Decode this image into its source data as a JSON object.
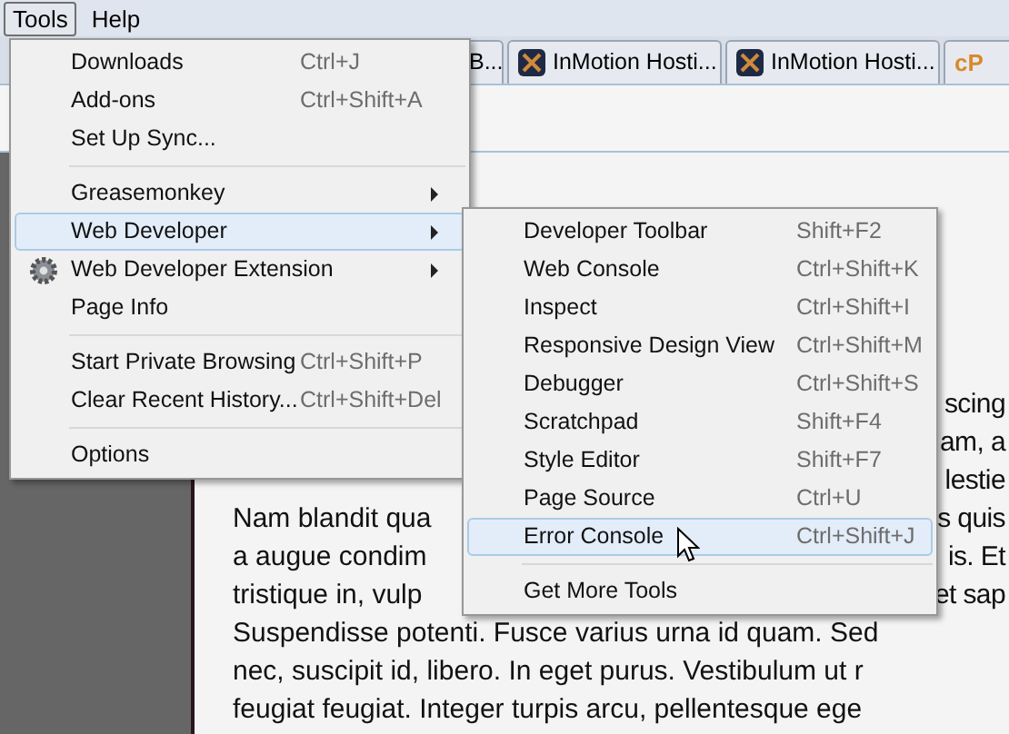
{
  "menu_bar": [
    {
      "label": "Tools",
      "selected": true
    },
    {
      "label": "Help",
      "selected": false
    }
  ],
  "tabs": [
    {
      "label": "B...",
      "kind": "plain"
    },
    {
      "label": "InMotion Hosti...",
      "kind": "site"
    },
    {
      "label": "InMotion Hosti...",
      "kind": "site"
    },
    {
      "kind": "cpanel",
      "logo_text": "cP"
    }
  ],
  "tools_menu": [
    {
      "kind": "item",
      "label": "Downloads",
      "shortcut": "Ctrl+J",
      "selected": false
    },
    {
      "kind": "item",
      "label": "Add-ons",
      "shortcut": "Ctrl+Shift+A",
      "selected": false
    },
    {
      "kind": "item",
      "label": "Set Up Sync...",
      "selected": false
    },
    {
      "kind": "separator"
    },
    {
      "kind": "submenu",
      "label": "Greasemonkey",
      "selected": false
    },
    {
      "kind": "submenu",
      "label": "Web Developer",
      "selected": true
    },
    {
      "kind": "submenu",
      "label": "Web Developer Extension",
      "selected": false,
      "icon": true
    },
    {
      "kind": "item",
      "label": "Page Info",
      "selected": false
    },
    {
      "kind": "separator"
    },
    {
      "kind": "item",
      "label": "Start Private Browsing",
      "shortcut": "Ctrl+Shift+P",
      "selected": false
    },
    {
      "kind": "item",
      "label": "Clear Recent History...",
      "shortcut": "Ctrl+Shift+Del",
      "selected": false
    },
    {
      "kind": "separator"
    },
    {
      "kind": "item",
      "label": "Options",
      "selected": false
    }
  ],
  "web_developer_menu": [
    {
      "kind": "item",
      "label": "Developer Toolbar",
      "shortcut": "Shift+F2",
      "selected": false
    },
    {
      "kind": "item",
      "label": "Web Console",
      "shortcut": "Ctrl+Shift+K",
      "selected": false
    },
    {
      "kind": "item",
      "label": "Inspect",
      "shortcut": "Ctrl+Shift+I",
      "selected": false
    },
    {
      "kind": "item",
      "label": "Responsive Design View",
      "shortcut": "Ctrl+Shift+M",
      "selected": false
    },
    {
      "kind": "item",
      "label": "Debugger",
      "shortcut": "Ctrl+Shift+S",
      "selected": false
    },
    {
      "kind": "item",
      "label": "Scratchpad",
      "shortcut": "Shift+F4",
      "selected": false
    },
    {
      "kind": "item",
      "label": "Style Editor",
      "shortcut": "Shift+F7",
      "selected": false
    },
    {
      "kind": "item",
      "label": "Page Source",
      "shortcut": "Ctrl+U",
      "selected": false
    },
    {
      "kind": "item",
      "label": "Error Console",
      "shortcut": "Ctrl+Shift+J",
      "selected": true
    },
    {
      "kind": "separator"
    },
    {
      "kind": "item",
      "label": "Get More Tools",
      "selected": false
    }
  ],
  "page_text": [
    {
      "right": "scing"
    },
    {
      "right": "am, a"
    },
    {
      "right": "lestie"
    },
    {
      "left": "Nam blandit qua",
      "right": "s quis"
    },
    {
      "left": "a augue condim",
      "right": "is. Et"
    },
    {
      "left": "tristique in, vulp",
      "right": "et sap"
    },
    {
      "left": "Suspendisse potenti. Fusce varius urna id quam. Sed"
    },
    {
      "left": "nec, suscipit id, libero. In eget purus. Vestibulum ut r"
    },
    {
      "left": "feugiat feugiat. Integer turpis arcu, pellentesque ege"
    }
  ]
}
